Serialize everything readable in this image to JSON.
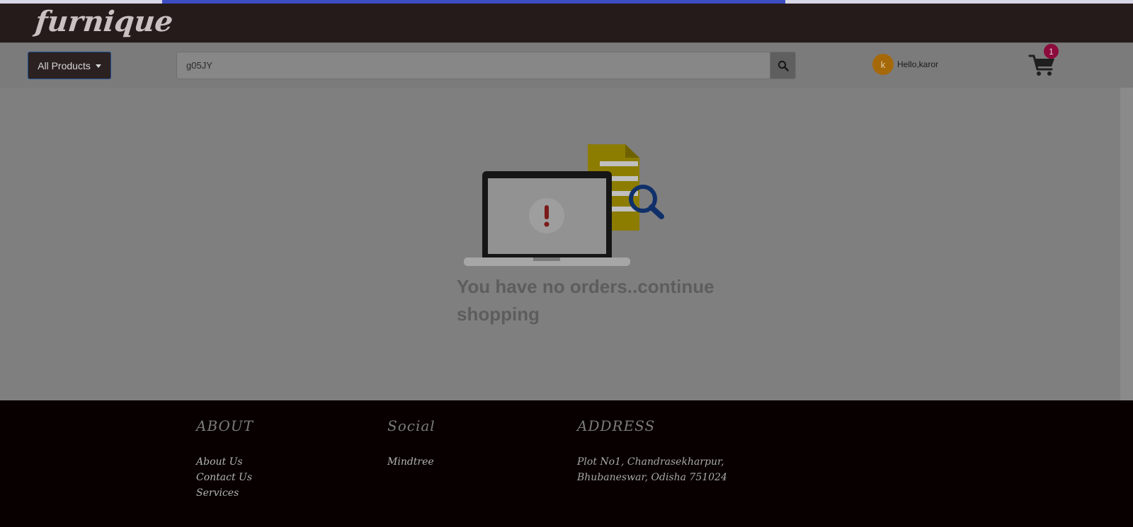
{
  "navbar": {
    "logo": "furnique",
    "progress_fraction": 0.55
  },
  "toolbar": {
    "all_products_label": "All Products",
    "search": {
      "value": "g05JY",
      "placeholder": ""
    },
    "user": {
      "initial": "k",
      "greeting": "Hello,karor"
    },
    "cart": {
      "count": "1"
    }
  },
  "main": {
    "empty_message": "You have no orders..continue shopping"
  },
  "footer": {
    "about": {
      "heading": "ABOUT",
      "links": [
        "About Us",
        "Contact Us",
        "Services"
      ]
    },
    "social": {
      "heading": "Social",
      "links": [
        "Mindtree"
      ]
    },
    "address": {
      "heading": "ADDRESS",
      "line1": "Plot No1, Chandrasekharpur,",
      "line2": "Bhubaneswar, Odisha 751024"
    }
  },
  "colors": {
    "navbar": "#261b1b",
    "footer": "#080000",
    "badge": "#8c0b3c",
    "avatar": "#a5690a",
    "progress": "#3d4ec4"
  }
}
